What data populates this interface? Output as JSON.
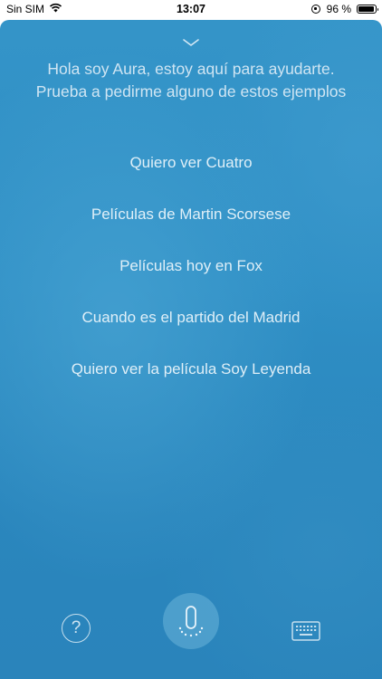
{
  "status": {
    "carrier": "Sin SIM",
    "time": "13:07",
    "battery": "96 %",
    "battery_level": 0.96
  },
  "intro": {
    "line1": "Hola soy Aura, estoy aquí para ayudarte.",
    "line2": "Prueba a pedirme alguno de estos ejemplos"
  },
  "suggestions": [
    "Quiero ver Cuatro",
    "Películas de Martin Scorsese",
    "Películas hoy en Fox",
    "Cuando es el partido del Madrid",
    "Quiero ver la película Soy Leyenda"
  ],
  "bottom": {
    "help_label": "?",
    "help_icon": "question-circle-icon",
    "mic_icon": "microphone-icon",
    "keyboard_icon": "keyboard-icon"
  },
  "colors": {
    "background": "#2f8fc5",
    "text": "#e6f1f8"
  }
}
